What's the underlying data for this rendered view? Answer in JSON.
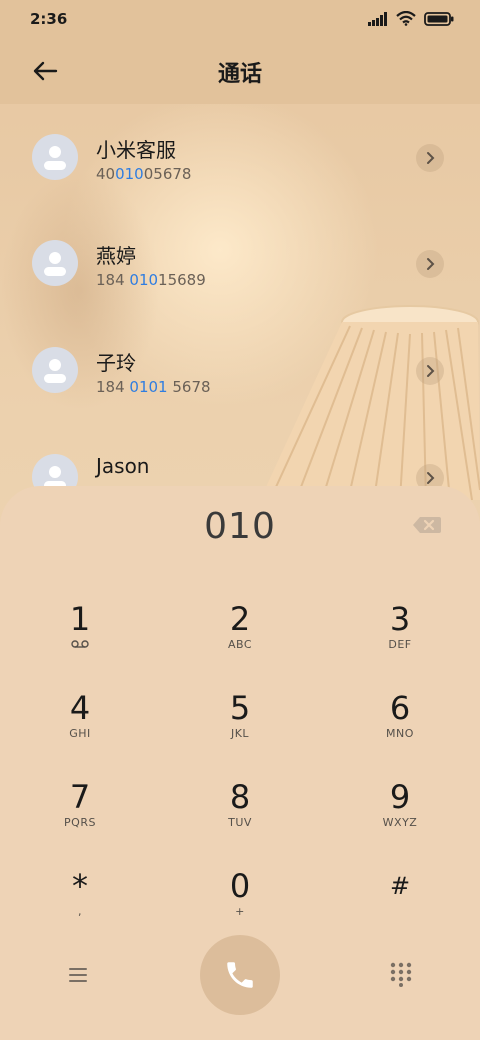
{
  "status_bar": {
    "time": "2:36",
    "icons": [
      "signal-icon",
      "wifi-icon",
      "battery-icon"
    ]
  },
  "header": {
    "title": "通话",
    "back_icon": "back-arrow-icon"
  },
  "contacts": [
    {
      "name": "小米客服",
      "number_parts": [
        "40",
        "010",
        "05678"
      ]
    },
    {
      "name": "燕婷",
      "number_parts": [
        "184 ",
        "010",
        "15689"
      ]
    },
    {
      "name": "子玲",
      "number_parts": [
        "184 ",
        "0101",
        " 5678"
      ]
    },
    {
      "name": "Jason",
      "number_parts": [
        "",
        "",
        ""
      ]
    }
  ],
  "dialer": {
    "input": "010",
    "backspace_icon": "backspace-icon",
    "keys": [
      {
        "digit": "1",
        "letters": ""
      },
      {
        "digit": "2",
        "letters": "ABC"
      },
      {
        "digit": "3",
        "letters": "DEF"
      },
      {
        "digit": "4",
        "letters": "GHI"
      },
      {
        "digit": "5",
        "letters": "JKL"
      },
      {
        "digit": "6",
        "letters": "MNO"
      },
      {
        "digit": "7",
        "letters": "PQRS"
      },
      {
        "digit": "8",
        "letters": "TUV"
      },
      {
        "digit": "9",
        "letters": "WXYZ"
      },
      {
        "digit": "*",
        "letters": ","
      },
      {
        "digit": "0",
        "letters": "+"
      },
      {
        "digit": "#",
        "letters": ""
      }
    ],
    "bottom": {
      "menu_icon": "menu-icon",
      "call_icon": "phone-icon",
      "keypad_icon": "dialpad-icon"
    }
  },
  "colors": {
    "highlight": "#2f7de1",
    "header_bg": "#e2c29b",
    "sheet_bg": "#eed3b6",
    "call_button": "#dcbd9b"
  }
}
